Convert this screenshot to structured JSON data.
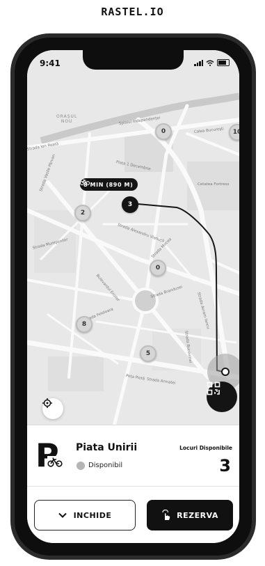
{
  "brand": "RASTEL.IO",
  "statusbar": {
    "time": "9:41"
  },
  "map": {
    "district_label": "ORAȘUL\nNOU",
    "streets": [
      "Splaiul Independenței",
      "Strada Ion Roată",
      "Cetatea Fortress",
      "Calea Bucureşti",
      "Piața 1 Decembrie",
      "Strada Alexandru Vlahuță",
      "Strada Mureşenilor",
      "Strada Mircea",
      "Strada Avram Iancu",
      "Strada Bucovinei",
      "Strada Feldioara",
      "Bulevardul Eroilor",
      "Strada Brandusei",
      "Peța Pietă",
      "Strada Armatei",
      "Strada Vasile Pârvan"
    ],
    "markers": [
      "0",
      "10",
      "3",
      "2",
      "0",
      "8",
      "5"
    ],
    "route_tag": "8 MIN (890 M)"
  },
  "station": {
    "name": "Piata Unirii",
    "status": "Disponibil",
    "available_label": "Locuri Disponibile",
    "available_count": "3"
  },
  "actions": {
    "close_label": "INCHIDE",
    "reserve_label": "REZERVA"
  }
}
